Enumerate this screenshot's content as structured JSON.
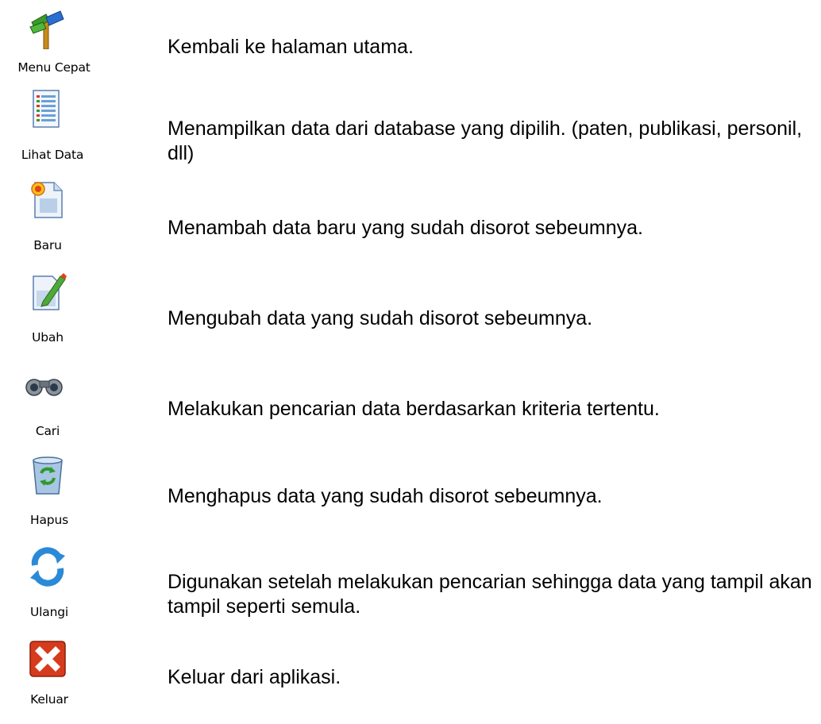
{
  "toolbar_legend": [
    {
      "label": "Menu Cepat",
      "icon": "signpost-icon",
      "description": "Kembali ke halaman utama."
    },
    {
      "label": "Lihat Data",
      "icon": "data-list-icon",
      "description": "Menampilkan data dari database yang dipilih. (paten, publikasi, personil, dll)"
    },
    {
      "label": "Baru",
      "icon": "new-document-icon",
      "description": "Menambah data baru yang sudah disorot sebeumnya."
    },
    {
      "label": "Ubah",
      "icon": "edit-document-icon",
      "description": "Mengubah data yang sudah disorot sebeumnya."
    },
    {
      "label": "Cari",
      "icon": "binoculars-icon",
      "description": "Melakukan pencarian data berdasarkan kriteria tertentu."
    },
    {
      "label": "Hapus",
      "icon": "recycle-bin-icon",
      "description": "Menghapus data yang sudah disorot sebeumnya."
    },
    {
      "label": "Ulangi",
      "icon": "refresh-icon",
      "description": "Digunakan setelah melakukan pencarian sehingga data yang tampil akan tampil seperti semula."
    },
    {
      "label": "Keluar",
      "icon": "close-x-icon",
      "description": "Keluar dari aplikasi."
    }
  ],
  "colors": {
    "exit_red": "#d63b1e",
    "refresh_blue": "#2a8ad8",
    "signpost_green": "#3b9a2a",
    "page_background": "#ffffff"
  }
}
